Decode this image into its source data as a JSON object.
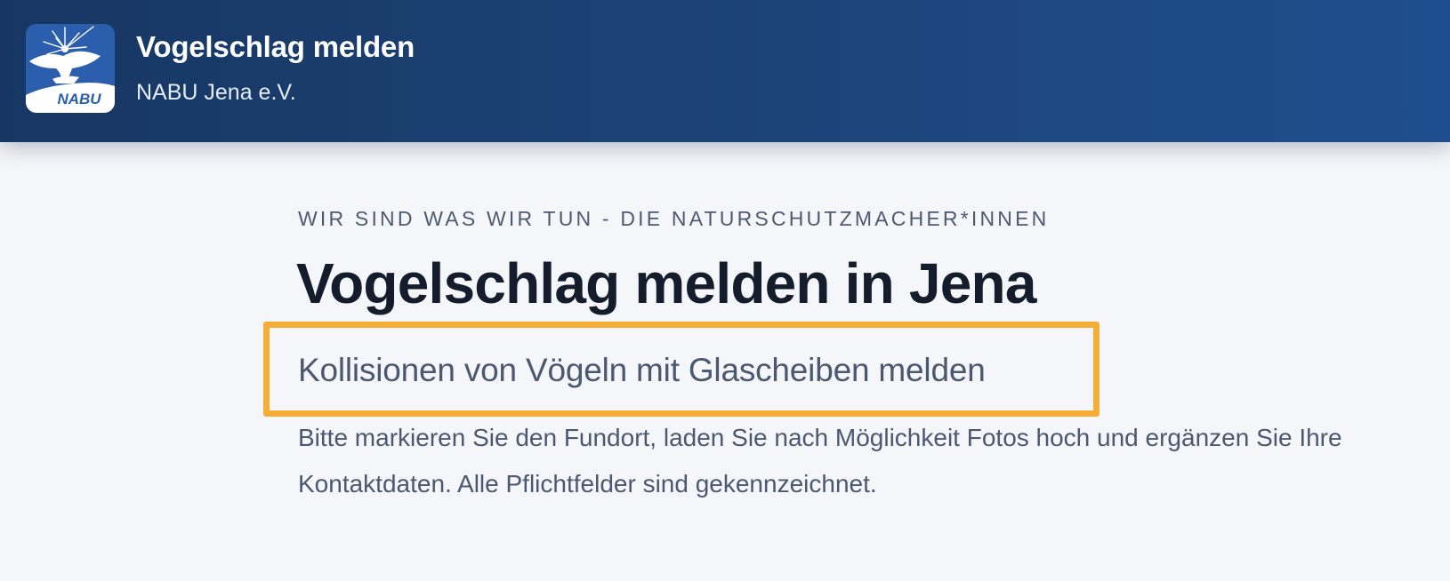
{
  "header": {
    "title": "Vogelschlag melden",
    "subtitle": "NABU Jena e.V.",
    "logo": {
      "icon": "nabu-bird-icon",
      "text": "NABU"
    }
  },
  "main": {
    "eyebrow": "WIR SIND WAS WIR TUN - DIE NATURSCHUTZMACHER*INNEN",
    "title": "Vogelschlag melden in Jena",
    "subtitle": "Kollisionen von Vögeln mit Glascheiben melden",
    "intro": "Bitte markieren Sie den Fundort, laden Sie nach Möglichkeit Fotos hoch und ergänzen Sie Ihre Kontaktdaten. Alle Pflichtfelder sind gekennzeichnet."
  },
  "colors": {
    "header_start": "#173763",
    "header_end": "#1f4e8e",
    "logo_bg": "#2c5eae",
    "highlight": "#f5ad35",
    "page_bg": "#f5f6fa"
  }
}
